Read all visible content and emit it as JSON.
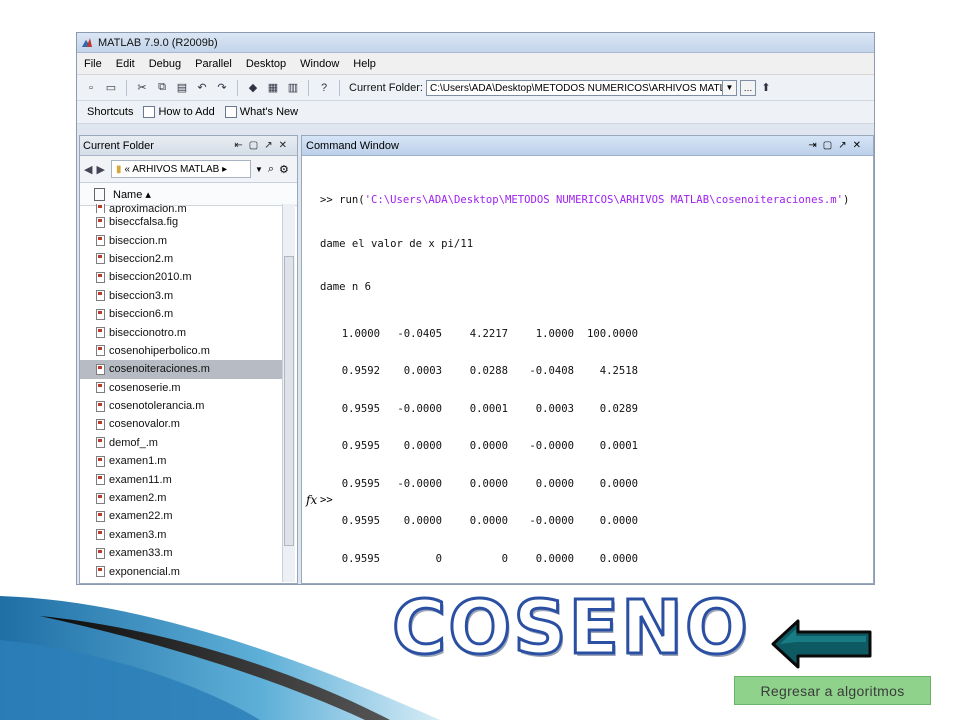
{
  "matlab": {
    "title": "MATLAB 7.9.0 (R2009b)",
    "menu": [
      "File",
      "Edit",
      "Debug",
      "Parallel",
      "Desktop",
      "Window",
      "Help"
    ],
    "toolbar": {
      "current_folder_label": "Current Folder:",
      "current_folder_value": "C:\\Users\\ADA\\Desktop\\METODOS NUMERICOS\\ARHIVOS MATLAB"
    },
    "shortcuts": [
      "Shortcuts",
      "How to Add",
      "What's New"
    ],
    "current_folder_panel": {
      "title": "Current Folder",
      "breadcrumb": "« ARHIVOS MATLAB ▸",
      "column_header": "Name ▴",
      "files": [
        "aproximacion.m",
        "biseccfalsa.fig",
        "biseccion.m",
        "biseccion2.m",
        "biseccion2010.m",
        "biseccion3.m",
        "biseccion6.m",
        "biseccionotro.m",
        "cosenohiperbolico.m",
        "cosenoiteraciones.m",
        "cosenoserie.m",
        "cosenotolerancia.m",
        "cosenovalor.m",
        "demof_.m",
        "examen1.m",
        "examen11.m",
        "examen2.m",
        "examen22.m",
        "examen3.m",
        "examen33.m",
        "exponencial.m"
      ],
      "selected_file": "cosenoiteraciones.m"
    },
    "command_window": {
      "title": "Command Window",
      "run_prefix": ">> run(",
      "run_path": "'C:\\Users\\ADA\\Desktop\\METODOS NUMERICOS\\ARHIVOS MATLAB\\cosenoiteraciones.m'",
      "run_suffix": ")",
      "line_x": "dame el valor de x pi/11",
      "line_n": "dame n 6",
      "rows": [
        [
          "1.0000",
          "-0.0405",
          "4.2217",
          "1.0000",
          "100.0000"
        ],
        [
          "0.9592",
          "0.0003",
          "0.0288",
          "-0.0408",
          "4.2518"
        ],
        [
          "0.9595",
          "-0.0000",
          "0.0001",
          "0.0003",
          "0.0289"
        ],
        [
          "0.9595",
          "0.0000",
          "0.0000",
          "-0.0000",
          "0.0001"
        ],
        [
          "0.9595",
          "-0.0000",
          "0.0000",
          "0.0000",
          "0.0000"
        ],
        [
          "0.9595",
          "0.0000",
          "0.0000",
          "-0.0000",
          "0.0000"
        ],
        [
          "0.9595",
          "0",
          "0",
          "0.0000",
          "0.0000"
        ]
      ],
      "prompt": ">>",
      "fx": "fx"
    }
  },
  "slide": {
    "title": "COSENO",
    "back_link": "Regresar a algoritmos"
  }
}
